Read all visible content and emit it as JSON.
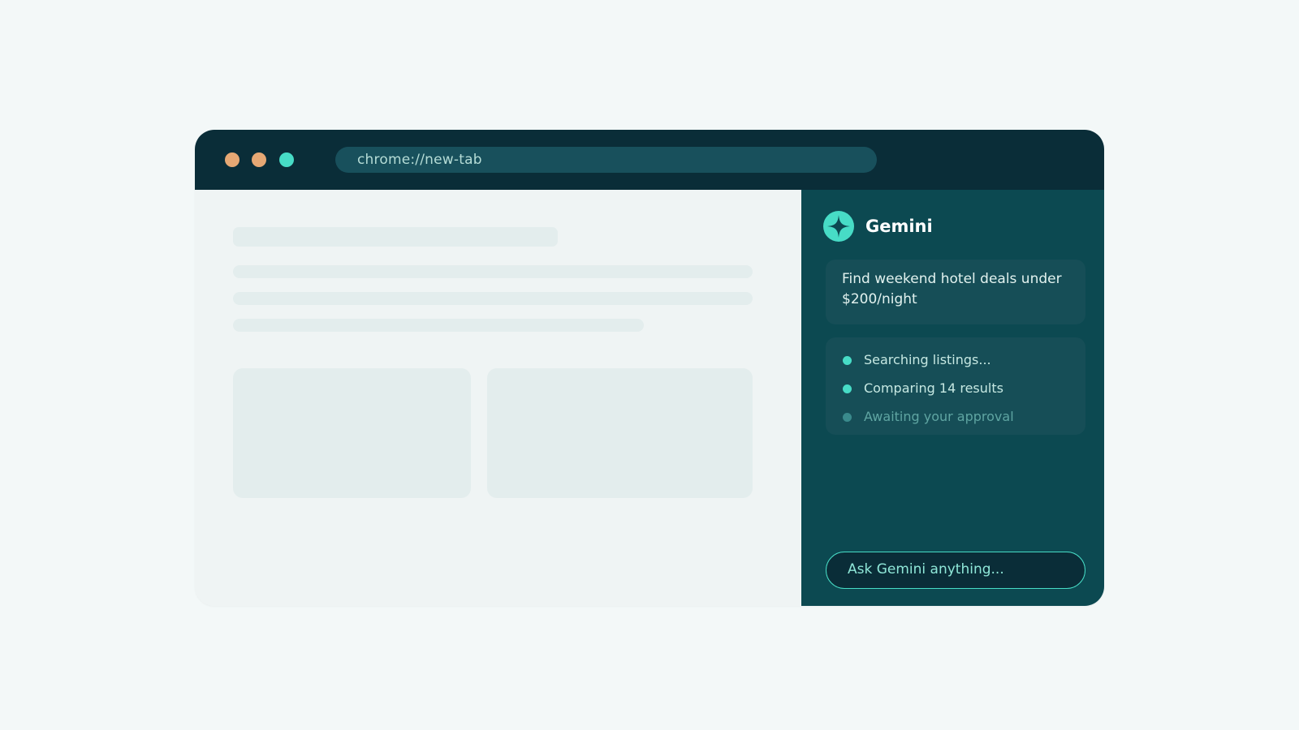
{
  "browser": {
    "address_bar": "chrome://new-tab"
  },
  "panel": {
    "title": "Gemini",
    "logo_icon": "gemini-sparkle-icon",
    "prompt": "Find weekend hotel deals under $200/night",
    "status_items": [
      {
        "label": "Searching listings...",
        "state": "active"
      },
      {
        "label": "Comparing 14 results",
        "state": "active"
      },
      {
        "label": "Awaiting your approval",
        "state": "pending"
      }
    ],
    "input_placeholder": "Ask Gemini anything..."
  },
  "colors": {
    "background": "#f3f8f8",
    "titlebar": "#0a2d38",
    "panel": "#0c4951",
    "accent": "#47dcc6",
    "window_dot": "#e6a874"
  }
}
